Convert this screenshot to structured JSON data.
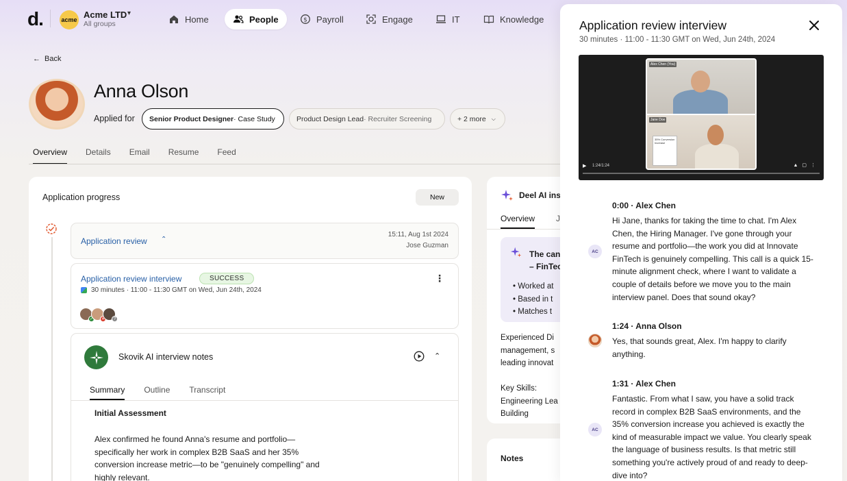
{
  "brand": {
    "logo": "d.",
    "accent": "#6a4fd8"
  },
  "org": {
    "badge": "acme",
    "name": "Acme LTD",
    "sub": "All groups"
  },
  "nav": [
    {
      "label": "Home",
      "icon": "home-icon",
      "active": false
    },
    {
      "label": "People",
      "icon": "people-icon",
      "active": true
    },
    {
      "label": "Payroll",
      "icon": "dollar-icon",
      "active": false
    },
    {
      "label": "Engage",
      "icon": "engage-icon",
      "active": false
    },
    {
      "label": "IT",
      "icon": "laptop-icon",
      "active": false
    },
    {
      "label": "Knowledge",
      "icon": "book-icon",
      "active": false
    }
  ],
  "page": {
    "back_label": "Back",
    "name": "Anna Olson",
    "applied_for_label": "Applied for",
    "chips": [
      {
        "bold": "Senior Product Designer",
        "rest": " · Case Study",
        "selected": true
      },
      {
        "bold": "Product Design Lead",
        "rest": " · Recruiter Screening",
        "selected": false
      },
      {
        "bold": "",
        "rest": "+ 2 more",
        "selected": false
      }
    ],
    "tabs": [
      "Overview",
      "Details",
      "Email",
      "Resume",
      "Feed"
    ]
  },
  "progress": {
    "title": "Application progress",
    "new_button": "New",
    "stage": {
      "title": "Application review",
      "date": "15:11, Aug 1st 2024",
      "by": "Jose Guzman"
    },
    "interview": {
      "title": "Application review interview",
      "status": "SUCCESS",
      "meta": "30 minutes · 11:00 - 11:30 GMT on Wed, Jun 24th, 2024"
    },
    "notes": {
      "title": "Skovik AI interview notes",
      "tabs": [
        "Summary",
        "Outline",
        "Transcript"
      ],
      "section_title": "Initial Assessment",
      "body": "Alex confirmed he found Anna's resume and portfolio—specifically her work in complex B2B SaaS and her 35% conversion increase metric—to be \"genuinely compelling\" and highly relevant."
    }
  },
  "ai": {
    "title": "Deel AI ins",
    "tabs": [
      "Overview",
      "J"
    ],
    "highlight_title_1": "The can",
    "highlight_title_2": "– FinTec",
    "bullets": [
      "Worked at",
      "Based in t",
      "Matches t"
    ],
    "para": [
      "Experienced Di",
      "management, s",
      "leading innovat"
    ],
    "skills": [
      "Key Skills:",
      "Engineering Lea",
      "Building"
    ],
    "notes_label": "Notes"
  },
  "drawer": {
    "title": "Application review interview",
    "subtitle": "30 minutes · 11:00 - 11:30 GMT on Wed, Jun 24th, 2024",
    "video": {
      "label_top": "Alex Chen (You)",
      "label_bottom": "Jane Doe",
      "time": "1:24/1:24",
      "mini_caption": "35% Conversion Increase"
    },
    "transcript": [
      {
        "time_speaker": "0:00 · Alex Chen",
        "initials": "AC",
        "text": "Hi Jane, thanks for taking the time to chat. I'm Alex Chen, the Hiring Manager. I've gone through your resume and portfolio—the work you did at Innovate FinTech is genuinely compelling. This call is a quick 15-minute alignment check, where I want to validate a couple of details before we move you to the main interview panel. Does that sound okay?"
      },
      {
        "time_speaker": "1:24 · Anna Olson",
        "initials": "",
        "text": "Yes, that sounds great, Alex. I'm happy to clarify anything."
      },
      {
        "time_speaker": "1:31 · Alex Chen",
        "initials": "AC",
        "text": "Fantastic. From what I saw, you have a solid track record in complex B2B SaaS environments, and the 35% conversion increase you achieved is exactly the kind of measurable impact we value. You clearly speak the language of business results. Is that metric still something you're actively proud of and ready to deep-dive into?"
      }
    ]
  }
}
